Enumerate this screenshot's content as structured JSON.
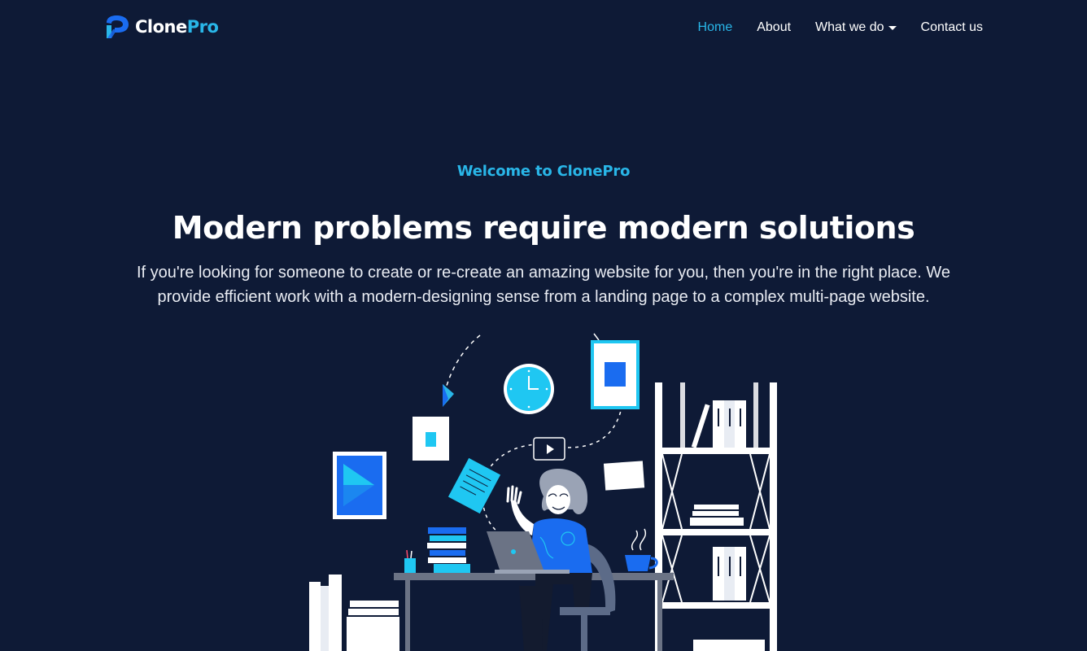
{
  "brand": {
    "name_primary": "Clone",
    "name_accent": "Pro",
    "logo_icon": "clonepro-logo-icon"
  },
  "nav": {
    "items": [
      {
        "label": "Home",
        "active": true
      },
      {
        "label": "About",
        "active": false
      },
      {
        "label": "What we do",
        "active": false,
        "dropdown": true
      },
      {
        "label": "Contact us",
        "active": false
      }
    ]
  },
  "hero": {
    "eyebrow": "Welcome to ClonePro",
    "headline": "Modern problems require modern solutions",
    "lead": "If you're looking for someone to create or re-create an amazing website for you, then you're in the right place. We provide efficient work with a modern-designing sense from a landing page to a complex multi-page website."
  },
  "colors": {
    "background": "#0e1a36",
    "accent": "#29b6e8",
    "text": "#ffffff",
    "illustration_blue": "#1a6cf0",
    "illustration_cyan": "#1fc7f2"
  }
}
